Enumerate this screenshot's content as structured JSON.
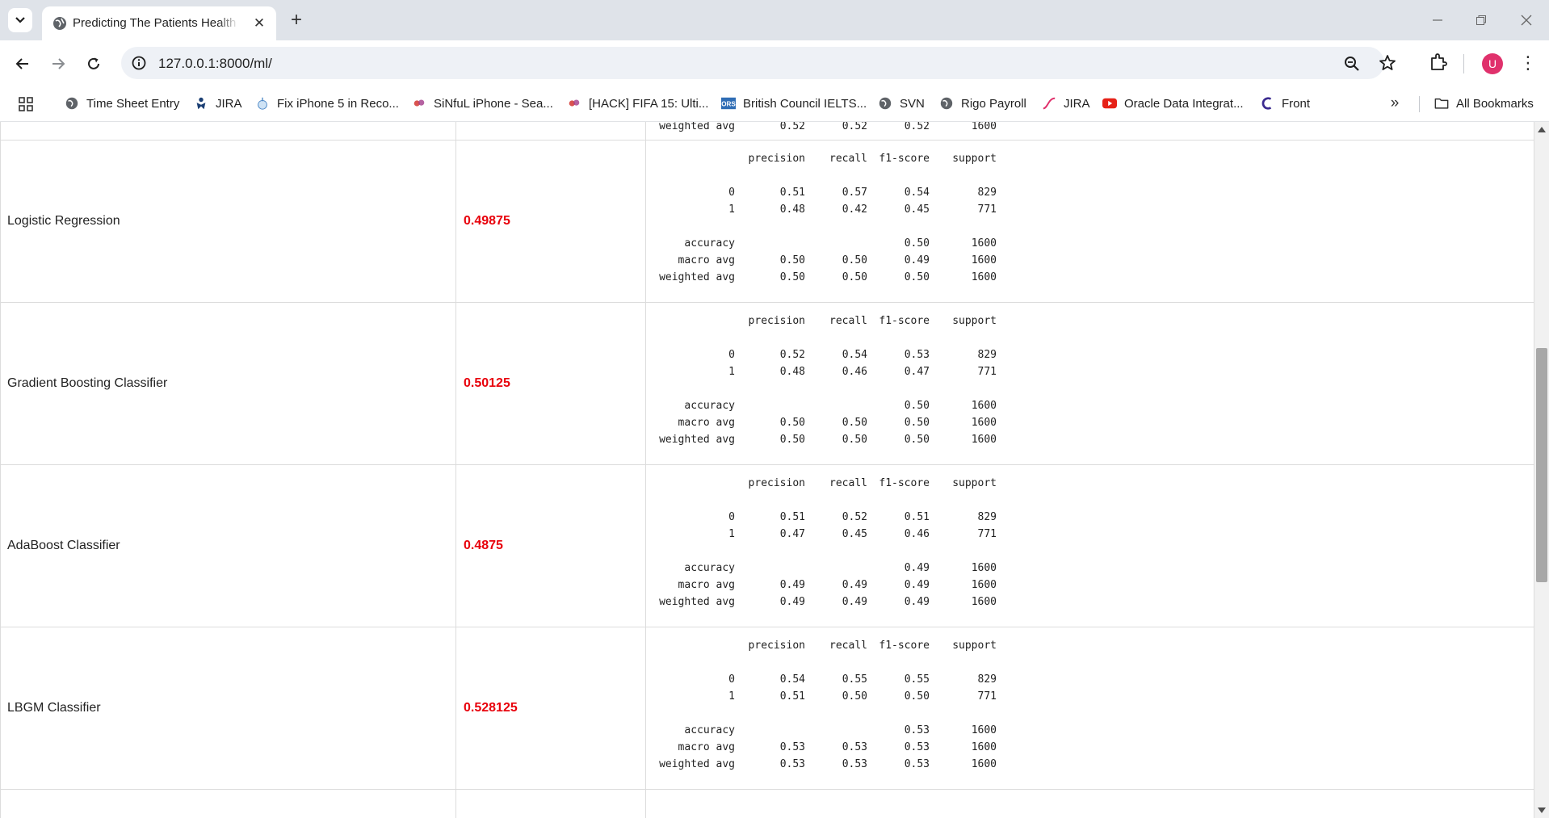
{
  "browser": {
    "tab_title": "Predicting The Patients Health A",
    "url": "127.0.0.1:8000/ml/",
    "avatar_letter": "U",
    "bookmarks": [
      {
        "label": "Time Sheet Entry",
        "icon": "globe-icon"
      },
      {
        "label": "JIRA",
        "icon": "jira-icon"
      },
      {
        "label": "Fix iPhone 5 in Reco...",
        "icon": "iphone-icon"
      },
      {
        "label": "SiNfuL iPhone - Sea...",
        "icon": "sinful-icon"
      },
      {
        "label": "[HACK] FIFA 15: Ulti...",
        "icon": "sinful-icon"
      },
      {
        "label": "British Council IELTS...",
        "icon": "ors-icon"
      },
      {
        "label": "SVN",
        "icon": "globe-icon"
      },
      {
        "label": "Rigo Payroll",
        "icon": "globe-icon"
      },
      {
        "label": "JIRA",
        "icon": "jira-swoosh-icon"
      },
      {
        "label": "Oracle Data Integrat...",
        "icon": "youtube-icon"
      },
      {
        "label": "Front",
        "icon": "front-icon"
      }
    ],
    "all_bookmarks": "All Bookmarks",
    "accent_avatar": "#e0316c"
  },
  "partial_row": {
    "label": "weighted avg",
    "precision": "0.52",
    "recall": "0.52",
    "f1": "0.52",
    "support": "1600"
  },
  "report_header": {
    "precision": "precision",
    "recall": "recall",
    "f1": "f1-score",
    "support": "support"
  },
  "models": [
    {
      "name": "Logistic Regression",
      "accuracy": "0.49875",
      "rows": {
        "c0": [
          "0",
          "0.51",
          "0.57",
          "0.54",
          "829"
        ],
        "c1": [
          "1",
          "0.48",
          "0.42",
          "0.45",
          "771"
        ],
        "acc": [
          "accuracy",
          "",
          "",
          "0.50",
          "1600"
        ],
        "macro": [
          "macro avg",
          "0.50",
          "0.50",
          "0.49",
          "1600"
        ],
        "weighted": [
          "weighted avg",
          "0.50",
          "0.50",
          "0.50",
          "1600"
        ]
      }
    },
    {
      "name": "Gradient Boosting Classifier",
      "accuracy": "0.50125",
      "rows": {
        "c0": [
          "0",
          "0.52",
          "0.54",
          "0.53",
          "829"
        ],
        "c1": [
          "1",
          "0.48",
          "0.46",
          "0.47",
          "771"
        ],
        "acc": [
          "accuracy",
          "",
          "",
          "0.50",
          "1600"
        ],
        "macro": [
          "macro avg",
          "0.50",
          "0.50",
          "0.50",
          "1600"
        ],
        "weighted": [
          "weighted avg",
          "0.50",
          "0.50",
          "0.50",
          "1600"
        ]
      }
    },
    {
      "name": "AdaBoost Classifier",
      "accuracy": "0.4875",
      "rows": {
        "c0": [
          "0",
          "0.51",
          "0.52",
          "0.51",
          "829"
        ],
        "c1": [
          "1",
          "0.47",
          "0.45",
          "0.46",
          "771"
        ],
        "acc": [
          "accuracy",
          "",
          "",
          "0.49",
          "1600"
        ],
        "macro": [
          "macro avg",
          "0.49",
          "0.49",
          "0.49",
          "1600"
        ],
        "weighted": [
          "weighted avg",
          "0.49",
          "0.49",
          "0.49",
          "1600"
        ]
      }
    },
    {
      "name": "LBGM Classifier",
      "accuracy": "0.528125",
      "rows": {
        "c0": [
          "0",
          "0.54",
          "0.55",
          "0.55",
          "829"
        ],
        "c1": [
          "1",
          "0.51",
          "0.50",
          "0.50",
          "771"
        ],
        "acc": [
          "accuracy",
          "",
          "",
          "0.53",
          "1600"
        ],
        "macro": [
          "macro avg",
          "0.53",
          "0.53",
          "0.53",
          "1600"
        ],
        "weighted": [
          "weighted avg",
          "0.53",
          "0.53",
          "0.53",
          "1600"
        ]
      }
    }
  ],
  "colors": {
    "accuracy_text": "#e8000b",
    "tabstrip_bg": "#dfe3e9",
    "omnibox_bg": "#eef1f6"
  }
}
